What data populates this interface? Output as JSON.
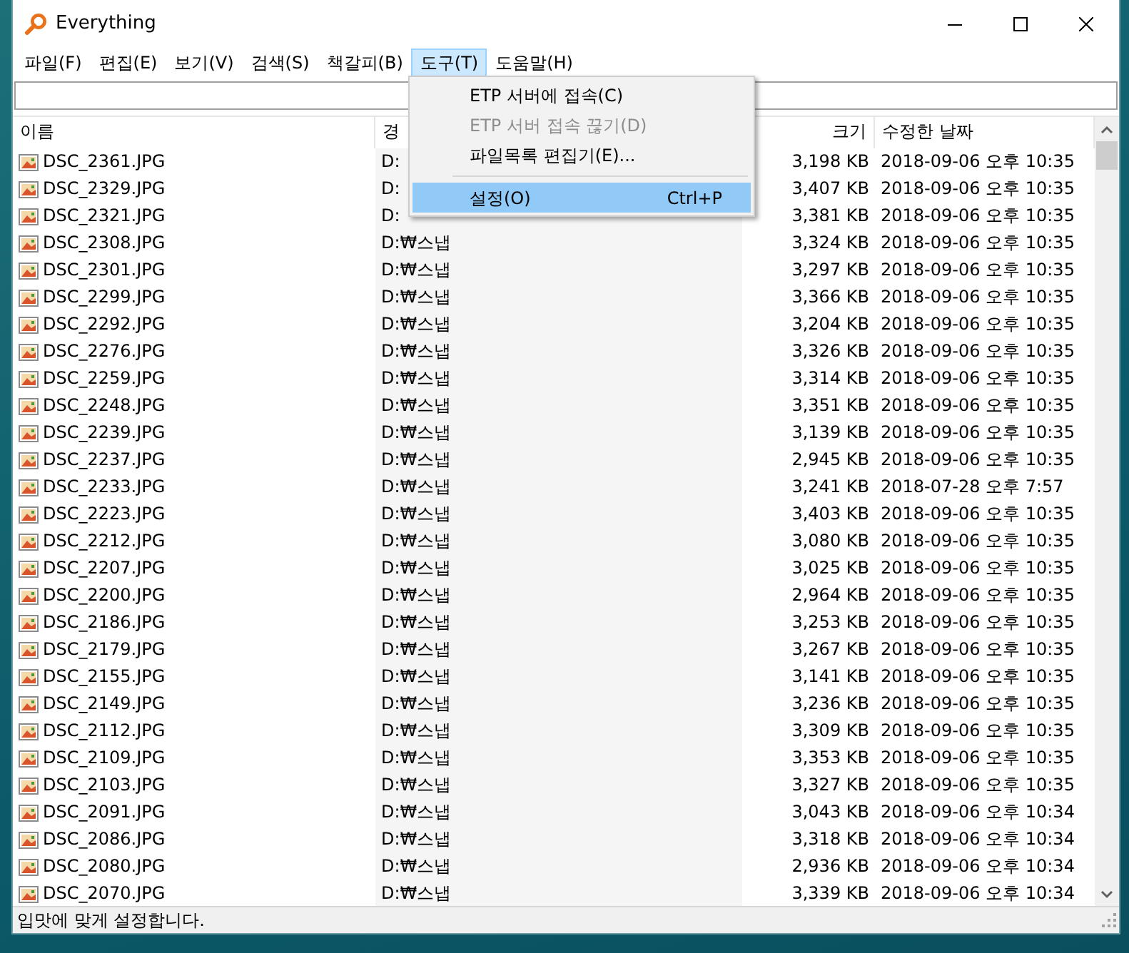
{
  "window": {
    "title": "Everything"
  },
  "menu_bar": [
    {
      "label": "파일(F)",
      "selected": false
    },
    {
      "label": "편집(E)",
      "selected": false
    },
    {
      "label": "보기(V)",
      "selected": false
    },
    {
      "label": "검색(S)",
      "selected": false
    },
    {
      "label": "책갈피(B)",
      "selected": false
    },
    {
      "label": "도구(T)",
      "selected": true
    },
    {
      "label": "도움말(H)",
      "selected": false
    }
  ],
  "dropdown": [
    {
      "kind": "item",
      "label": "ETP 서버에 접속(C)",
      "disabled": false,
      "selected": false
    },
    {
      "kind": "item",
      "label": "ETP 서버 접속 끊기(D)",
      "disabled": true,
      "selected": false
    },
    {
      "kind": "item",
      "label": "파일목록 편집기(E)...",
      "disabled": false,
      "selected": false
    },
    {
      "kind": "separator"
    },
    {
      "kind": "item",
      "label": "설정(O)",
      "shortcut": "Ctrl+P",
      "disabled": false,
      "selected": true
    }
  ],
  "table": {
    "columns": [
      "이름",
      "경",
      "크기",
      "수정한 날짜"
    ],
    "rows": [
      {
        "name": "DSC_2361.JPG",
        "path": "D:",
        "size": "3,198 KB",
        "modified": "2018-09-06 오후 10:35"
      },
      {
        "name": "DSC_2329.JPG",
        "path": "D:",
        "size": "3,407 KB",
        "modified": "2018-09-06 오후 10:35"
      },
      {
        "name": "DSC_2321.JPG",
        "path": "D:",
        "size": "3,381 KB",
        "modified": "2018-09-06 오후 10:35"
      },
      {
        "name": "DSC_2308.JPG",
        "path": "D:₩스냅",
        "size": "3,324 KB",
        "modified": "2018-09-06 오후 10:35"
      },
      {
        "name": "DSC_2301.JPG",
        "path": "D:₩스냅",
        "size": "3,297 KB",
        "modified": "2018-09-06 오후 10:35"
      },
      {
        "name": "DSC_2299.JPG",
        "path": "D:₩스냅",
        "size": "3,366 KB",
        "modified": "2018-09-06 오후 10:35"
      },
      {
        "name": "DSC_2292.JPG",
        "path": "D:₩스냅",
        "size": "3,204 KB",
        "modified": "2018-09-06 오후 10:35"
      },
      {
        "name": "DSC_2276.JPG",
        "path": "D:₩스냅",
        "size": "3,326 KB",
        "modified": "2018-09-06 오후 10:35"
      },
      {
        "name": "DSC_2259.JPG",
        "path": "D:₩스냅",
        "size": "3,314 KB",
        "modified": "2018-09-06 오후 10:35"
      },
      {
        "name": "DSC_2248.JPG",
        "path": "D:₩스냅",
        "size": "3,351 KB",
        "modified": "2018-09-06 오후 10:35"
      },
      {
        "name": "DSC_2239.JPG",
        "path": "D:₩스냅",
        "size": "3,139 KB",
        "modified": "2018-09-06 오후 10:35"
      },
      {
        "name": "DSC_2237.JPG",
        "path": "D:₩스냅",
        "size": "2,945 KB",
        "modified": "2018-09-06 오후 10:35"
      },
      {
        "name": "DSC_2233.JPG",
        "path": "D:₩스냅",
        "size": "3,241 KB",
        "modified": "2018-07-28 오후 7:57"
      },
      {
        "name": "DSC_2223.JPG",
        "path": "D:₩스냅",
        "size": "3,403 KB",
        "modified": "2018-09-06 오후 10:35"
      },
      {
        "name": "DSC_2212.JPG",
        "path": "D:₩스냅",
        "size": "3,080 KB",
        "modified": "2018-09-06 오후 10:35"
      },
      {
        "name": "DSC_2207.JPG",
        "path": "D:₩스냅",
        "size": "3,025 KB",
        "modified": "2018-09-06 오후 10:35"
      },
      {
        "name": "DSC_2200.JPG",
        "path": "D:₩스냅",
        "size": "2,964 KB",
        "modified": "2018-09-06 오후 10:35"
      },
      {
        "name": "DSC_2186.JPG",
        "path": "D:₩스냅",
        "size": "3,253 KB",
        "modified": "2018-09-06 오후 10:35"
      },
      {
        "name": "DSC_2179.JPG",
        "path": "D:₩스냅",
        "size": "3,267 KB",
        "modified": "2018-09-06 오후 10:35"
      },
      {
        "name": "DSC_2155.JPG",
        "path": "D:₩스냅",
        "size": "3,141 KB",
        "modified": "2018-09-06 오후 10:35"
      },
      {
        "name": "DSC_2149.JPG",
        "path": "D:₩스냅",
        "size": "3,236 KB",
        "modified": "2018-09-06 오후 10:35"
      },
      {
        "name": "DSC_2112.JPG",
        "path": "D:₩스냅",
        "size": "3,309 KB",
        "modified": "2018-09-06 오후 10:35"
      },
      {
        "name": "DSC_2109.JPG",
        "path": "D:₩스냅",
        "size": "3,353 KB",
        "modified": "2018-09-06 오후 10:35"
      },
      {
        "name": "DSC_2103.JPG",
        "path": "D:₩스냅",
        "size": "3,327 KB",
        "modified": "2018-09-06 오후 10:35"
      },
      {
        "name": "DSC_2091.JPG",
        "path": "D:₩스냅",
        "size": "3,043 KB",
        "modified": "2018-09-06 오후 10:34"
      },
      {
        "name": "DSC_2086.JPG",
        "path": "D:₩스냅",
        "size": "3,318 KB",
        "modified": "2018-09-06 오후 10:34"
      },
      {
        "name": "DSC_2080.JPG",
        "path": "D:₩스냅",
        "size": "2,936 KB",
        "modified": "2018-09-06 오후 10:34"
      },
      {
        "name": "DSC_2070.JPG",
        "path": "D:₩스냅",
        "size": "3,339 KB",
        "modified": "2018-09-06 오후 10:34"
      }
    ]
  },
  "status_bar": "입맛에 맞게 설정합니다."
}
